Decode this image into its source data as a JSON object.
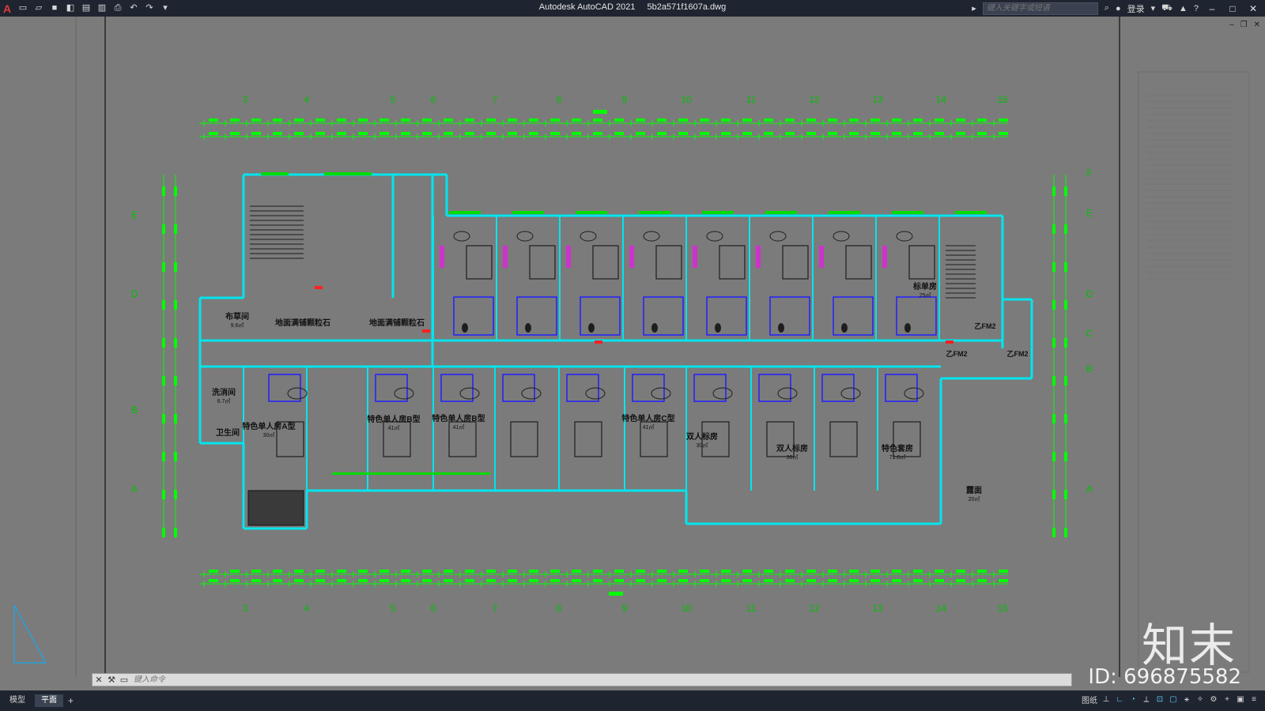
{
  "app": {
    "title": "Autodesk AutoCAD 2021",
    "file": "5b2a571f1607a.dwg"
  },
  "toolbar": {
    "icons": [
      "autocad-logo",
      "new-icon",
      "open-icon",
      "save-icon",
      "saveas-icon",
      "open-web-icon",
      "save-web-icon",
      "plot-icon",
      "undo-icon",
      "redo-icon",
      "customize-icon"
    ]
  },
  "search": {
    "placeholder": "键入关键字或短语"
  },
  "user": {
    "login_label": "登录"
  },
  "drawing": {
    "grid_numbers_top": [
      "3",
      "4",
      "5",
      "6",
      "7",
      "8",
      "9",
      "10",
      "11",
      "12",
      "13",
      "14",
      "15"
    ],
    "grid_numbers_bottom": [
      "3",
      "4",
      "5",
      "6",
      "7",
      "8",
      "9",
      "10",
      "11",
      "12",
      "13",
      "14",
      "15"
    ],
    "grid_letters_left": [
      "E",
      "D",
      "B",
      "A"
    ],
    "grid_letters_right": [
      "F",
      "E",
      "D",
      "C",
      "B",
      "A"
    ],
    "rooms": [
      {
        "name": "布草间",
        "area": "9.6㎡"
      },
      {
        "name": "地面满铺颗粒石"
      },
      {
        "name": "地面满铺颗粒石"
      },
      {
        "name": "洗消间",
        "area": "6.7㎡"
      },
      {
        "name": "卫生间"
      },
      {
        "name": "特色单人房A型",
        "area": "30㎡"
      },
      {
        "name": "特色单人房B型",
        "area": "41㎡"
      },
      {
        "name": "特色单人房B型",
        "area": "41㎡"
      },
      {
        "name": "特色单人房C型",
        "area": "41㎡"
      },
      {
        "name": "双人标房",
        "area": "30㎡"
      },
      {
        "name": "双人标房",
        "area": "30㎡"
      },
      {
        "name": "特色套房",
        "area": "71.6㎡"
      },
      {
        "name": "标单房",
        "area": "25㎡"
      },
      {
        "name": "露面",
        "area": "20㎡"
      }
    ],
    "door_tags": [
      "乙FM2",
      "乙FM2",
      "乙FM2"
    ],
    "colors": {
      "background": "#7b7b7b",
      "walls": "#00e5ee",
      "dimensions": "#00ff00",
      "fixtures": "#1e1e1e",
      "blue": "#2020ff",
      "magenta": "#cc33cc"
    }
  },
  "command": {
    "placeholder": "键入命令"
  },
  "layout_tabs": [
    "模型",
    "平面"
  ],
  "status": {
    "paper_label": "图纸",
    "tools": [
      "snap-icon",
      "ortho-icon",
      "polar-icon",
      "isodraft-icon",
      "osnap-icon",
      "otrack-icon",
      "annotation-icon",
      "workspace-icon",
      "units-icon",
      "settings-icon",
      "fullscreen-icon",
      "menu-icon"
    ]
  },
  "watermark": {
    "brand": "知末",
    "id": "ID: 696875582"
  }
}
